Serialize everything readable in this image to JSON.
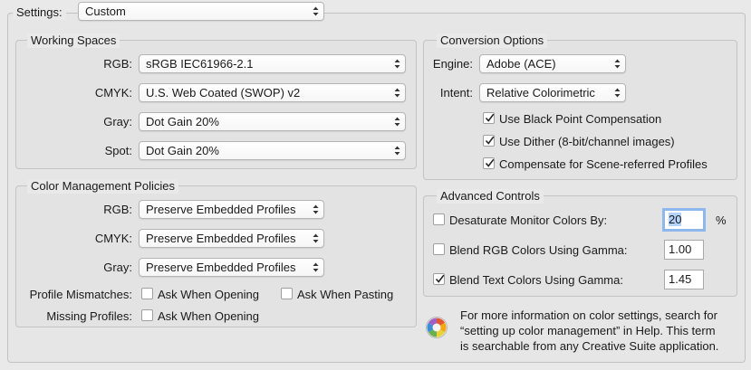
{
  "settings": {
    "label": "Settings:",
    "value": "Custom"
  },
  "working_spaces": {
    "title": "Working Spaces",
    "rows": [
      {
        "label": "RGB:",
        "value": "sRGB IEC61966-2.1"
      },
      {
        "label": "CMYK:",
        "value": "U.S. Web Coated (SWOP) v2"
      },
      {
        "label": "Gray:",
        "value": "Dot Gain 20%"
      },
      {
        "label": "Spot:",
        "value": "Dot Gain 20%"
      }
    ]
  },
  "policies": {
    "title": "Color Management Policies",
    "rows": [
      {
        "label": "RGB:",
        "value": "Preserve Embedded Profiles"
      },
      {
        "label": "CMYK:",
        "value": "Preserve Embedded Profiles"
      },
      {
        "label": "Gray:",
        "value": "Preserve Embedded Profiles"
      }
    ],
    "mismatch_label": "Profile Mismatches:",
    "ask_opening": "Ask When Opening",
    "ask_pasting": "Ask When Pasting",
    "missing_label": "Missing Profiles:",
    "missing_ask_opening": "Ask When Opening",
    "checks": {
      "mismatch_opening": false,
      "mismatch_pasting": false,
      "missing_opening": false
    }
  },
  "conversion": {
    "title": "Conversion Options",
    "engine_label": "Engine:",
    "engine_value": "Adobe (ACE)",
    "intent_label": "Intent:",
    "intent_value": "Relative Colorimetric",
    "options": [
      {
        "label": "Use Black Point Compensation",
        "checked": true
      },
      {
        "label": "Use Dither (8-bit/channel images)",
        "checked": true
      },
      {
        "label": "Compensate for Scene-referred Profiles",
        "checked": true
      }
    ]
  },
  "advanced": {
    "title": "Advanced Controls",
    "desaturate_label": "Desaturate Monitor Colors By:",
    "desaturate_value": "20",
    "desaturate_unit": "%",
    "blend_rgb_label": "Blend RGB Colors Using Gamma:",
    "blend_rgb_value": "1.00",
    "blend_text_label": "Blend Text Colors Using Gamma:",
    "blend_text_value": "1.45",
    "checks": {
      "desaturate": false,
      "blend_rgb": false,
      "blend_text": true
    }
  },
  "info": {
    "line1": "For more information on color settings, search for",
    "line2": "“setting up color management” in Help. This term",
    "line3": "is searchable from any Creative Suite application."
  }
}
